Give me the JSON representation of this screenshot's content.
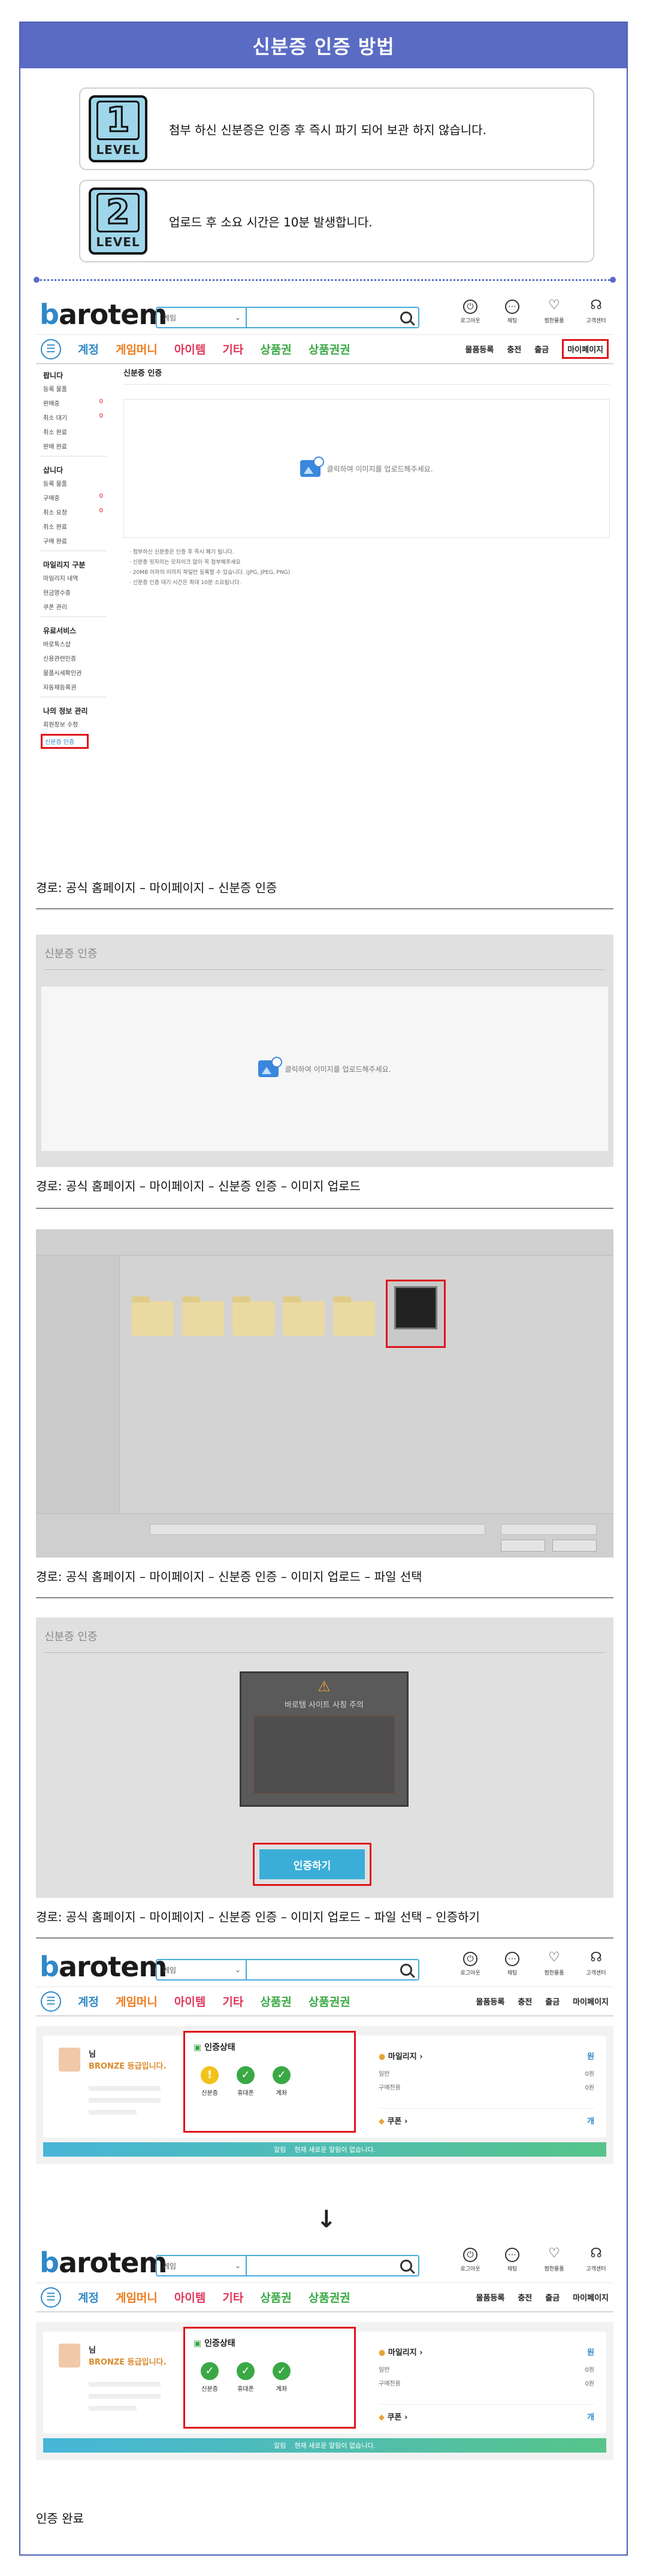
{
  "page_title": "신분증 인증 방법",
  "levels": [
    {
      "num": "1",
      "word": "LEVEL",
      "text": "첨부 하신 신분증은 인증 후 즉시 파기 되어 보관 하지 않습니다."
    },
    {
      "num": "2",
      "word": "LEVEL",
      "text": "업로드 후 소요 시간은 10분 발생합니다."
    }
  ],
  "header": {
    "logo_prefix": "b",
    "logo_rest": "arotem",
    "search_select": "게임",
    "icons": [
      {
        "name": "logout",
        "glyph": "⏻",
        "label": "로그아웃"
      },
      {
        "name": "chat",
        "glyph": "⋯",
        "label": "채팅"
      },
      {
        "name": "heart",
        "glyph": "♡",
        "label": "찜한물품"
      },
      {
        "name": "support",
        "glyph": "☊",
        "label": "고객센터"
      }
    ],
    "categories": [
      {
        "label": "계정",
        "color": "#2f88c8"
      },
      {
        "label": "게임머니",
        "color": "#ef7a1a"
      },
      {
        "label": "아이템",
        "color": "#e0365a"
      },
      {
        "label": "기타",
        "color": "#e0365a"
      },
      {
        "label": "상품권",
        "color": "#3aa845"
      },
      {
        "label": "상품권권",
        "color": "#3aa845"
      }
    ],
    "right_menu": [
      "물품등록",
      "충전",
      "출금",
      "마이페이지"
    ]
  },
  "sidebar": {
    "sections": [
      {
        "title": "팝니다",
        "items": [
          {
            "label": "등록 물품",
            "count": ""
          },
          {
            "label": "판매중",
            "count": "0"
          },
          {
            "label": "취소 대기",
            "count": "0"
          },
          {
            "label": "취소 완료",
            "count": ""
          },
          {
            "label": "판매 완료",
            "count": ""
          }
        ]
      },
      {
        "title": "삽니다",
        "items": [
          {
            "label": "등록 물품",
            "count": ""
          },
          {
            "label": "구매중",
            "count": "0"
          },
          {
            "label": "취소 요청",
            "count": "0"
          },
          {
            "label": "취소 완료",
            "count": ""
          },
          {
            "label": "구매 완료",
            "count": ""
          }
        ]
      },
      {
        "title": "마일리지 구분",
        "items": [
          {
            "label": "마일리지 내역",
            "count": ""
          },
          {
            "label": "현금영수증",
            "count": ""
          },
          {
            "label": "쿠폰 관리",
            "count": ""
          }
        ]
      },
      {
        "title": "유료서비스",
        "items": [
          {
            "label": "바로톡스샵",
            "count": ""
          },
          {
            "label": "신용관련인증",
            "count": ""
          },
          {
            "label": "물품시세확인권",
            "count": ""
          },
          {
            "label": "자동재등록권",
            "count": ""
          }
        ]
      },
      {
        "title": "나의 정보 관리",
        "items": [
          {
            "label": "회원정보 수정",
            "count": ""
          },
          {
            "label": "신분증 인증",
            "count": ""
          }
        ]
      }
    ]
  },
  "verify": {
    "heading": "신분증 인증",
    "upload_prompt": "클릭하여 이미지를 업로드해주세요.",
    "notes": [
      "· 첨부하신 신분증은 인증 후 즉시 폐기 됩니다.",
      "· 신분증 뒷자리는 모자이크 없이 꼭 첨부해주세요",
      "· 20MB 이하의 이미지 파일만 등록할 수 있습니다. (JPG, JPEG, PNG)",
      "· 신분증 인증 대기 시간은 최대 10분 소요됩니다."
    ]
  },
  "captions": [
    "경로: 공식 홈페이지 – 마이페이지 – 신분증 인증",
    "경로: 공식 홈페이지 – 마이페이지 – 신분증 인증 – 이미지 업로드",
    "경로: 공식 홈페이지 – 마이페이지 – 신분증 인증 – 이미지 업로드 – 파일 선택",
    "경로: 공식 홈페이지 – 마이페이지 – 신분증 인증 – 이미지 업로드 – 파일 선택 – 인증하기",
    "인증 완료"
  ],
  "dialog": {
    "confirm_button": "인증하기",
    "warning_title": "바로템 사이트 사칭 주의"
  },
  "dashboard": {
    "grade_suffix": "님",
    "grade": "BRONZE 등급입니다.",
    "status_title": "인증상태",
    "before": [
      {
        "label": "신분증",
        "state": "pending",
        "glyph": "!"
      },
      {
        "label": "휴대폰",
        "state": "done",
        "glyph": "✓"
      },
      {
        "label": "계좌",
        "state": "done",
        "glyph": "✓"
      }
    ],
    "after": [
      {
        "label": "신분증",
        "state": "done",
        "glyph": "✓"
      },
      {
        "label": "휴대폰",
        "state": "done",
        "glyph": "✓"
      },
      {
        "label": "계좌",
        "state": "done",
        "glyph": "✓"
      }
    ],
    "mileage_title": "마일리지",
    "mileage_unit": "원",
    "mileage_rows": [
      {
        "label": "일반",
        "value": "0원"
      },
      {
        "label": "구매전용",
        "value": "0원"
      }
    ],
    "coupon_title": "쿠폰",
    "coupon_unit": "개",
    "notice_label": "알림",
    "notice_text": "현재 새로운 알림이 없습니다."
  },
  "colors": {
    "accent": "#5a6bc4",
    "highlight": "#e0121a",
    "brand": "#2f88c8"
  }
}
